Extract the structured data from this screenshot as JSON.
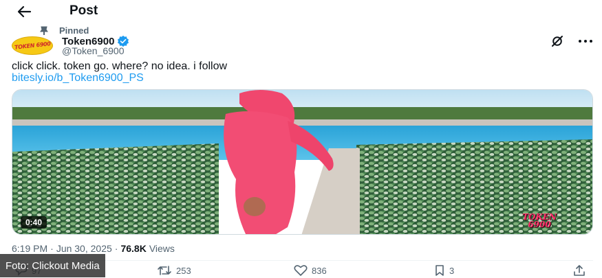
{
  "header": {
    "title": "Post"
  },
  "pinned": {
    "label": "Pinned"
  },
  "author": {
    "display_name": "Token6900",
    "handle": "@Token_6900",
    "avatar_text": "TOKEN 6900"
  },
  "tweet": {
    "text": "click click. token go. where? no idea. i follow",
    "link": "bitesly.io/b_Token6900_PS"
  },
  "media": {
    "duration": "0:40",
    "watermark_line1": "TOKEN",
    "watermark_line2": "6900"
  },
  "meta": {
    "time": "6:19 PM",
    "sep1": "·",
    "date": "Jun 30, 2025",
    "sep2": "·",
    "views_count": "76.8K",
    "views_label": "Views"
  },
  "actions": {
    "replies": "97",
    "reposts": "253",
    "likes": "836",
    "bookmarks": "3"
  },
  "caption": {
    "text": "Foto: Clickout Media"
  },
  "colors": {
    "link": "#1d9bf0",
    "verified": "#1d9bf0",
    "watermark": "#ff2f6a"
  }
}
